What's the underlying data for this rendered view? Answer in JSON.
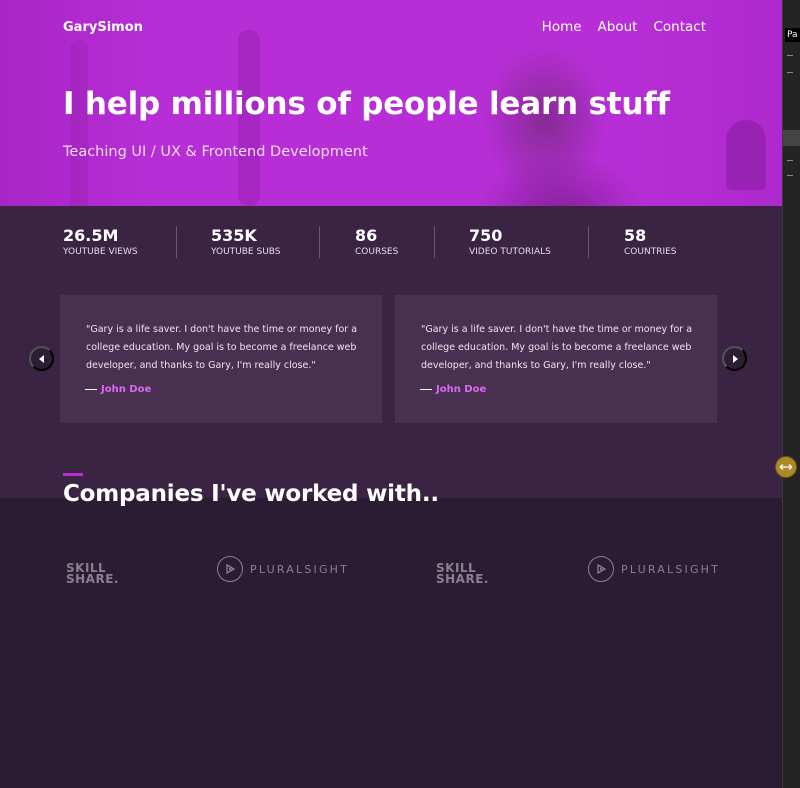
{
  "header": {
    "logo": "GarySimon",
    "nav": [
      "Home",
      "About",
      "Contact"
    ]
  },
  "hero": {
    "title": "I help millions of people learn stuff",
    "subtitle": "Teaching UI / UX & Frontend Development"
  },
  "stats": [
    {
      "value": "26.5M",
      "label": "YOUTUBE VIEWS"
    },
    {
      "value": "535K",
      "label": "YOUTUBE SUBS"
    },
    {
      "value": "86",
      "label": "COURSES"
    },
    {
      "value": "750",
      "label": "VIDEO TUTORIALS"
    },
    {
      "value": "58",
      "label": "COUNTRIES"
    }
  ],
  "testimonials": [
    {
      "quote": "\"Gary is a life saver. I don't have the time or money for a college education. My goal is to become a freelance web developer, and thanks to Gary, I'm really close.\"",
      "author": "John Doe"
    },
    {
      "quote": "\"Gary is a life saver. I don't have the time or money for a college education. My goal is to become a freelance web developer, and thanks to Gary, I'm really close.\"",
      "author": "John Doe"
    }
  ],
  "companies": {
    "title": "Companies I've worked with..",
    "logos": [
      {
        "line1": "SKILL",
        "line2": "SHARE."
      },
      {
        "word": "PLURALSIGHT"
      },
      {
        "line1": "SKILL",
        "line2": "SHARE."
      },
      {
        "word": "PLURALSIGHT"
      }
    ]
  },
  "devtools": {
    "tab": "Pa"
  },
  "colors": {
    "hero": "#b72ed6",
    "band": "#3b2443",
    "page": "#2a1d33",
    "card": "#4a3050",
    "accent_name": "#d86cf0"
  }
}
